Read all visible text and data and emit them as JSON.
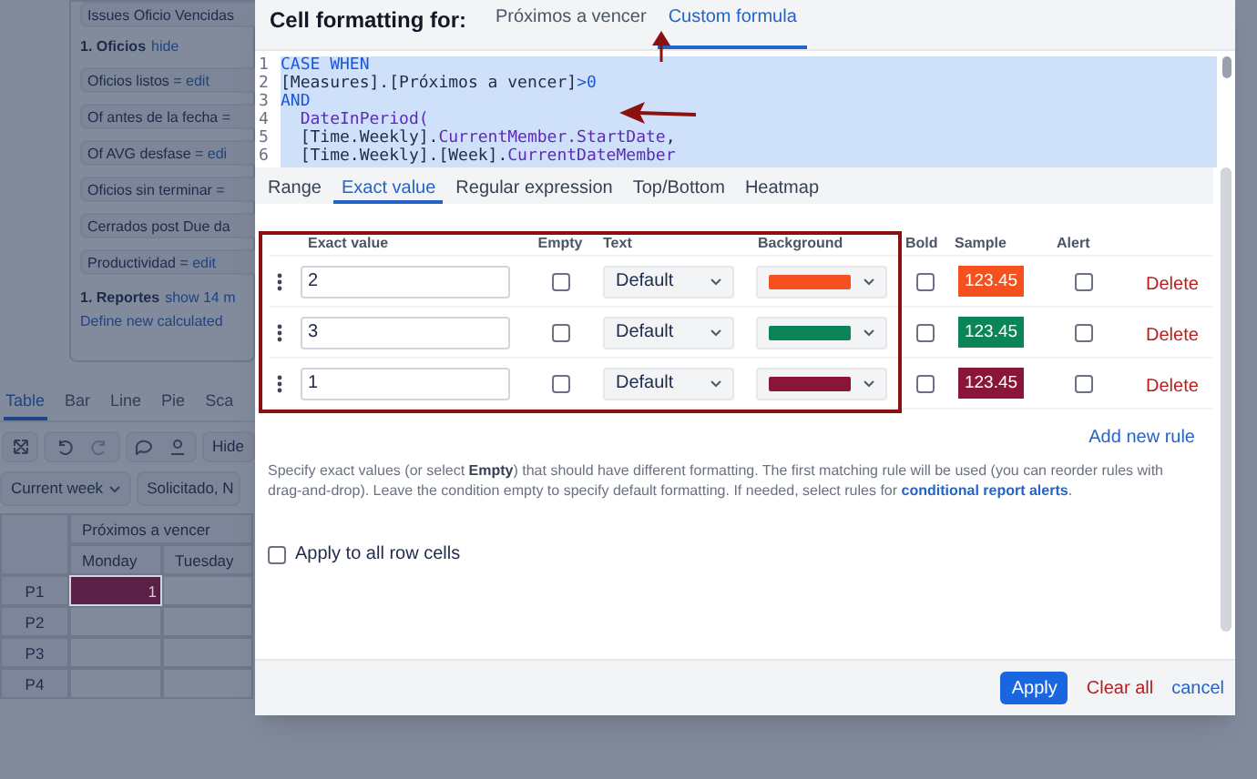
{
  "background": {
    "top_item": "Issues Oficio Vencidas",
    "sections": [
      {
        "title": "1. Oficios",
        "link": "hide",
        "items": [
          {
            "label": "Oficios listos = ",
            "link": "edit"
          },
          {
            "label": "Of antes de la fecha ="
          },
          {
            "label": "Of AVG desfase = ",
            "link": "edi"
          },
          {
            "label": "Oficios sin terminar ="
          },
          {
            "label": "Cerrados post Due da"
          },
          {
            "label": "Productividad = ",
            "link": "edit"
          }
        ]
      },
      {
        "title": "1. Reportes",
        "link": "show 14 m"
      }
    ],
    "define_link": "Define new calculated",
    "tabs": [
      {
        "label": "Table",
        "selected": true
      },
      {
        "label": "Bar",
        "selected": false
      },
      {
        "label": "Line",
        "selected": false
      },
      {
        "label": "Pie",
        "selected": false
      },
      {
        "label": "Sca",
        "selected": false
      }
    ],
    "toolbar_button": "Hide",
    "filters": [
      "Current week",
      "Solicitado, N"
    ],
    "table": {
      "group": "Próximos a vencer",
      "columns": [
        "Monday",
        "Tuesday"
      ],
      "rows": [
        {
          "label": "P1",
          "cells": [
            {
              "text": "1",
              "color": "#5b2046"
            },
            {
              "text": ""
            }
          ]
        },
        {
          "label": "P2",
          "cells": [
            {
              "text": ""
            },
            {
              "text": ""
            }
          ]
        },
        {
          "label": "P3",
          "cells": [
            {
              "text": ""
            },
            {
              "text": ""
            }
          ]
        },
        {
          "label": "P4",
          "cells": [
            {
              "text": ""
            },
            {
              "text": ""
            }
          ]
        }
      ]
    }
  },
  "dialog": {
    "title": "Cell formatting for:",
    "tabs": [
      {
        "label": "Próximos a vencer",
        "selected": false
      },
      {
        "label": "Custom formula",
        "selected": true
      }
    ],
    "code": [
      {
        "number": "1",
        "tokens": [
          {
            "kind": "keyword",
            "text": "CASE WHEN"
          }
        ]
      },
      {
        "number": "2",
        "tokens": [
          {
            "kind": "plain",
            "text": "[Measures].[Próximos a vencer]"
          },
          {
            "kind": "keyword",
            "text": ">0"
          }
        ]
      },
      {
        "number": "3",
        "tokens": [
          {
            "kind": "keyword",
            "text": "AND"
          }
        ]
      },
      {
        "number": "4",
        "tokens": [
          {
            "kind": "func",
            "text": "  DateInPeriod("
          }
        ]
      },
      {
        "number": "5",
        "tokens": [
          {
            "kind": "plain",
            "text": "  [Time.Weekly]."
          },
          {
            "kind": "func",
            "text": "CurrentMember.StartDate"
          },
          {
            "kind": "plain",
            "text": ","
          }
        ]
      },
      {
        "number": "6",
        "tokens": [
          {
            "kind": "plain",
            "text": "  [Time.Weekly].[Week]."
          },
          {
            "kind": "func",
            "text": "CurrentDateMember"
          }
        ]
      }
    ],
    "rule_tabs": [
      {
        "label": "Range",
        "selected": false
      },
      {
        "label": "Exact value",
        "selected": true
      },
      {
        "label": "Regular expression",
        "selected": false
      },
      {
        "label": "Top/Bottom",
        "selected": false
      },
      {
        "label": "Heatmap",
        "selected": false
      }
    ],
    "columns": [
      "Exact value",
      "Empty",
      "Text",
      "Background",
      "Bold",
      "Sample",
      "Alert"
    ],
    "rules": [
      {
        "value": "2",
        "empty": false,
        "text": "Default",
        "color": "#f4511e",
        "bold": false,
        "sample": "123.45",
        "alert": false,
        "delete": "Delete"
      },
      {
        "value": "3",
        "empty": false,
        "text": "Default",
        "color": "#0b8457",
        "bold": false,
        "sample": "123.45",
        "alert": false,
        "delete": "Delete"
      },
      {
        "value": "1",
        "empty": false,
        "text": "Default",
        "color": "#8b1538",
        "bold": false,
        "sample": "123.45",
        "alert": false,
        "delete": "Delete"
      }
    ],
    "add_rule": "Add new rule",
    "help_text": "Specify exact values (or select **Empty**) that should have different formatting. The first matching rule will be used (you can reorder rules with drag-and-drop). Leave the condition empty to specify default formatting. If needed, select rules for ",
    "help_link": "conditional report alerts",
    "help_end": ".",
    "apply_all": {
      "label": "Apply to all row cells",
      "checked": false
    },
    "buttons": {
      "apply": "Apply",
      "clear": "Clear all",
      "cancel": "cancel"
    }
  }
}
